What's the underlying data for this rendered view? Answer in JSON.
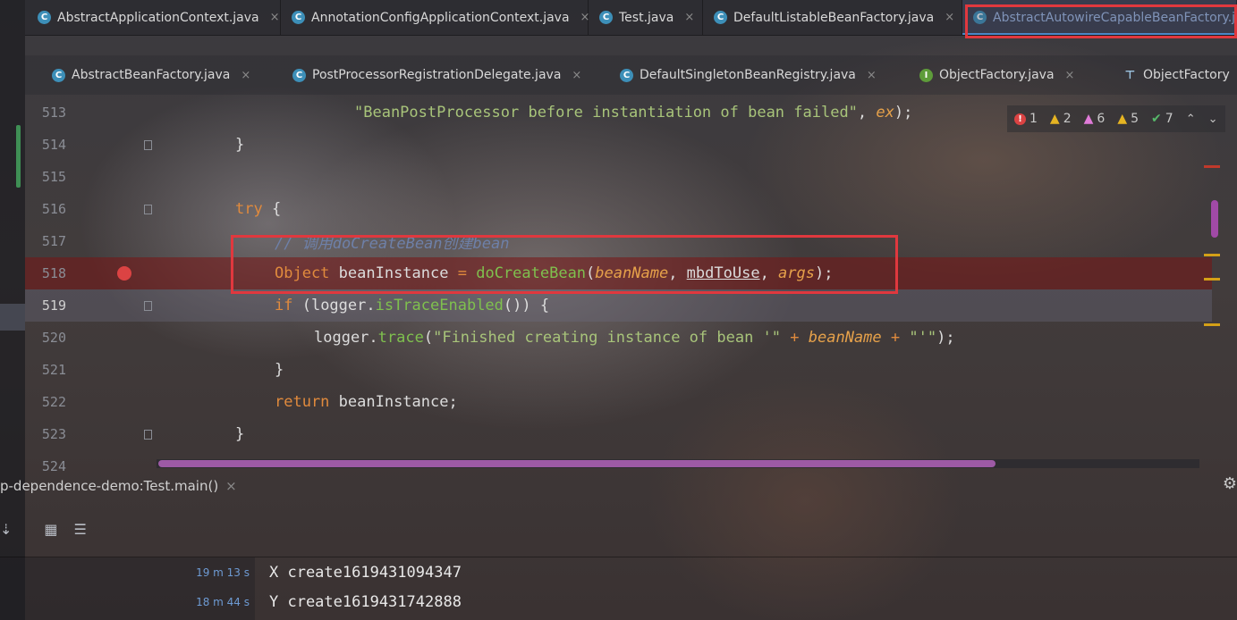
{
  "tabs_row1": [
    {
      "label": "AbstractApplicationContext.java",
      "icon": "class-icon"
    },
    {
      "label": "AnnotationConfigApplicationContext.java",
      "icon": "class-icon"
    },
    {
      "label": "Test.java",
      "icon": "class-icon"
    },
    {
      "label": "DefaultListableBeanFactory.java",
      "icon": "class-icon"
    },
    {
      "label": "AbstractAutowireCapableBeanFactory.java",
      "icon": "class-icon",
      "active": true
    }
  ],
  "tabs_row2": [
    {
      "label": "AbstractBeanFactory.java",
      "icon": "class-icon"
    },
    {
      "label": "PostProcessorRegistrationDelegate.java",
      "icon": "class-icon"
    },
    {
      "label": "DefaultSingletonBeanRegistry.java",
      "icon": "class-icon"
    },
    {
      "label": "ObjectFactory.java",
      "icon": "interface-icon"
    },
    {
      "label": "ObjectFactory",
      "icon": "structure-icon"
    }
  ],
  "close_glyph": "×",
  "editor": {
    "line_numbers": [
      "513",
      "514",
      "515",
      "516",
      "517",
      "518",
      "519",
      "520",
      "521",
      "522",
      "523",
      "524"
    ],
    "breakpoint_line": "518",
    "caret_line": "519",
    "code": {
      "l513_str": "\"BeanPostProcessor before instantiation of bean failed\"",
      "l513_rest": ", ",
      "l513_ex": "ex",
      "l513_end": ");",
      "l514": "}",
      "l516_kw": "try",
      "l516_rest": " {",
      "l517_comment": "// 调用doCreateBean创建bean",
      "l518_type": "Object",
      "l518_var": " beanInstance ",
      "l518_eq": "=",
      "l518_fn": "doCreateBean",
      "l518_open": "(",
      "l518_p1": "beanName",
      "l518_c1": ", ",
      "l518_p2": "mbdToUse",
      "l518_c2": ", ",
      "l518_p3": "args",
      "l518_close": ");",
      "l519_kw": "if",
      "l519_a": " (logger.",
      "l519_fn": "isTraceEnabled",
      "l519_b": "()) {",
      "l520_a": "logger.",
      "l520_fn": "trace",
      "l520_b": "(",
      "l520_str1": "\"Finished creating instance of bean '\"",
      "l520_plus1": " + ",
      "l520_p": "beanName",
      "l520_plus2": " + ",
      "l520_str2": "\"'\"",
      "l520_end": ");",
      "l521": "}",
      "l522_kw": "return",
      "l522_rest": " beanInstance;",
      "l523": "}"
    }
  },
  "inspections": {
    "errors": "1",
    "warnings": "2",
    "weak_warnings": "6",
    "typos": "5",
    "ok": "7"
  },
  "colors": {
    "highlight_box": "#e0383e",
    "breakpoint": "#db4343",
    "keyword": "#e08a3d",
    "string": "#a8c47a",
    "method": "#7fc04e",
    "param": "#e6a14a",
    "comment": "#6e80a8",
    "scroll_thumb": "#9d5aa5"
  },
  "run_panel": {
    "tab_label": "p-dependence-demo:Test.main()",
    "outputs": [
      {
        "elapsed": "19 m 13 s",
        "text": "X create1619431094347"
      },
      {
        "elapsed": "18 m 44 s",
        "text": "Y create1619431742888"
      }
    ]
  }
}
